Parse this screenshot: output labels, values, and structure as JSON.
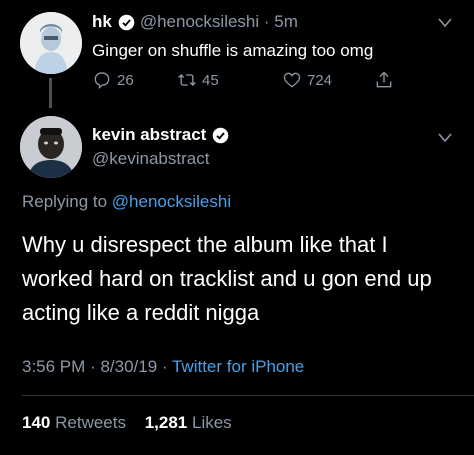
{
  "tweet1": {
    "name": "hk",
    "handle": "@henocksileshi",
    "time": "5m",
    "text": "Ginger on shuffle is amazing too omg",
    "replies": "26",
    "retweets": "45",
    "likes": "724"
  },
  "tweet2": {
    "name": "kevin abstract",
    "handle": "@kevinabstract",
    "replying_prefix": "Replying to",
    "replying_to": "@henocksileshi",
    "text": "Why u disrespect the album like that I worked hard on tracklist and u gon end up acting like a reddit nigga",
    "time": "3:56 PM",
    "date": "8/30/19",
    "source": "Twitter for iPhone",
    "retweet_count": "140",
    "retweet_label": "Retweets",
    "like_count": "1,281",
    "like_label": "Likes"
  },
  "colors": {
    "background": "#000000",
    "link": "#4a9fe8",
    "muted": "#8b98a5"
  },
  "icons": [
    "verified-icon",
    "reply-icon",
    "retweet-icon",
    "like-icon",
    "share-icon",
    "chevron-down-icon"
  ]
}
